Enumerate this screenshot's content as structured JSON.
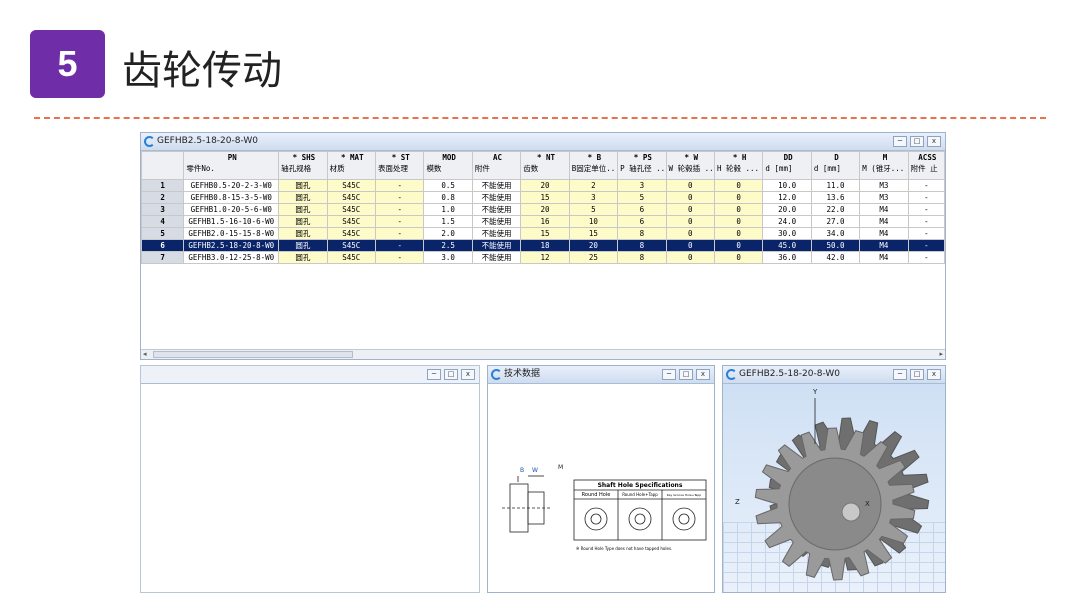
{
  "slide": {
    "badge_number": "5",
    "title": "齿轮传动"
  },
  "main_window": {
    "title": "GEFHB2.5-18-20-8-W0",
    "columns": [
      {
        "code": "PN",
        "label": "零件No."
      },
      {
        "code": "* SHS",
        "label": "轴孔规格"
      },
      {
        "code": "* MAT",
        "label": "材质"
      },
      {
        "code": "* ST",
        "label": "表面处理"
      },
      {
        "code": "MOD",
        "label": "模数"
      },
      {
        "code": "AC",
        "label": "附件"
      },
      {
        "code": "* NT",
        "label": "齿数"
      },
      {
        "code": "* B",
        "label": "B固定单位..."
      },
      {
        "code": "* PS",
        "label": "P 轴孔径 ..."
      },
      {
        "code": "* W",
        "label": "W 轮毂插 ..."
      },
      {
        "code": "* H",
        "label": "H 轮毂 ..."
      },
      {
        "code": "DD",
        "label": "d [mm]"
      },
      {
        "code": "D",
        "label": "d [mm]"
      },
      {
        "code": "M",
        "label": "M (锥牙..."
      },
      {
        "code": "ACSS",
        "label": "附件 止"
      }
    ],
    "rows": [
      {
        "n": "1",
        "pn": "GEFHB0.5-20-2-3-W0",
        "shs": "圆孔",
        "mat": "S45C",
        "st": "-",
        "mod": "0.5",
        "ac": "不能使用",
        "nt": "20",
        "b": "2",
        "ps": "3",
        "w": "0",
        "h": "0",
        "dd": "10.0",
        "d": "11.0",
        "m": "M3",
        "acss": "-"
      },
      {
        "n": "2",
        "pn": "GEFHB0.8-15-3-5-W0",
        "shs": "圆孔",
        "mat": "S45C",
        "st": "-",
        "mod": "0.8",
        "ac": "不能使用",
        "nt": "15",
        "b": "3",
        "ps": "5",
        "w": "0",
        "h": "0",
        "dd": "12.0",
        "d": "13.6",
        "m": "M3",
        "acss": "-"
      },
      {
        "n": "3",
        "pn": "GEFHB1.0-20-5-6-W0",
        "shs": "圆孔",
        "mat": "S45C",
        "st": "-",
        "mod": "1.0",
        "ac": "不能使用",
        "nt": "20",
        "b": "5",
        "ps": "6",
        "w": "0",
        "h": "0",
        "dd": "20.0",
        "d": "22.0",
        "m": "M4",
        "acss": "-"
      },
      {
        "n": "4",
        "pn": "GEFHB1.5-16-10-6-W0",
        "shs": "圆孔",
        "mat": "S45C",
        "st": "-",
        "mod": "1.5",
        "ac": "不能使用",
        "nt": "16",
        "b": "10",
        "ps": "6",
        "w": "0",
        "h": "0",
        "dd": "24.0",
        "d": "27.0",
        "m": "M4",
        "acss": "-"
      },
      {
        "n": "5",
        "pn": "GEFHB2.0-15-15-8-W0",
        "shs": "圆孔",
        "mat": "S45C",
        "st": "-",
        "mod": "2.0",
        "ac": "不能使用",
        "nt": "15",
        "b": "15",
        "ps": "8",
        "w": "0",
        "h": "0",
        "dd": "30.0",
        "d": "34.0",
        "m": "M4",
        "acss": "-"
      },
      {
        "n": "6",
        "pn": "GEFHB2.5-18-20-8-W0",
        "shs": "圆孔",
        "mat": "S45C",
        "st": "-",
        "mod": "2.5",
        "ac": "不能使用",
        "nt": "18",
        "b": "20",
        "ps": "8",
        "w": "0",
        "h": "0",
        "dd": "45.0",
        "d": "50.0",
        "m": "M4",
        "acss": "-",
        "selected": true
      },
      {
        "n": "7",
        "pn": "GEFHB3.0-12-25-8-W0",
        "shs": "圆孔",
        "mat": "S45C",
        "st": "-",
        "mod": "3.0",
        "ac": "不能使用",
        "nt": "12",
        "b": "25",
        "ps": "8",
        "w": "0",
        "h": "0",
        "dd": "36.0",
        "d": "42.0",
        "m": "M4",
        "acss": "-"
      }
    ]
  },
  "tech_window": {
    "title": "技术数据",
    "spec_title": "Shaft Hole Specifications",
    "col1": "Round Hole",
    "col2": "Round Hole+Tapp",
    "col3": "Key Groove Hole+Tapp",
    "note": "※ Round Hole Type does not have tapped holes.",
    "dim_b": "B",
    "dim_w": "W",
    "dim_m": "M"
  },
  "model_window": {
    "title": "GEFHB2.5-18-20-8-W0",
    "axis_y": "Y",
    "axis_z": "Z",
    "axis_x": "X"
  },
  "controls": {
    "min": "─",
    "max": "□",
    "close": "x"
  },
  "colors": {
    "badge": "#6f2da8",
    "dashed_line": "#e8734a",
    "selected_row": "#0a246a",
    "editable_cell": "#fdfbc8"
  }
}
